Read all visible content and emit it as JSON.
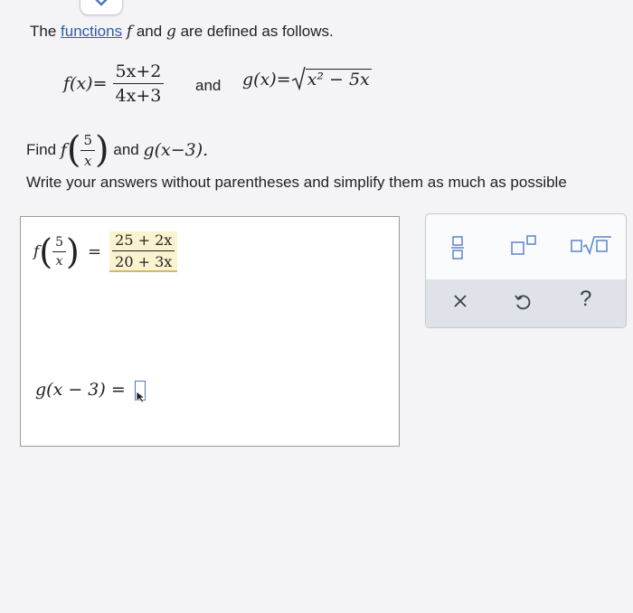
{
  "intro": {
    "prefix": "The",
    "link": "functions",
    "f": "f",
    "and": "and",
    "g": "g",
    "suffix": "are defined as follows."
  },
  "definitions": {
    "f_lhs": "f(x)=",
    "f_num": "5x+2",
    "f_den": "4x+3",
    "and_word": "and",
    "g_lhs": "g(x)=",
    "g_radicand": "x² − 5x"
  },
  "find": {
    "label": "Find",
    "f": "f",
    "frac_num": "5",
    "frac_den": "x",
    "and": "and",
    "g_expr": "g(x−3)."
  },
  "instruction": "Write your answers without parentheses and simplify them as much as possible",
  "answers": {
    "a1_f": "f",
    "a1_frac_num": "5",
    "a1_frac_den": "x",
    "a1_eq": "=",
    "a1_num": "25 + 2x",
    "a1_den": "20 + 3x",
    "a2_lhs": "g(x − 3) ="
  },
  "toolbar": {
    "icons": [
      "fraction-icon",
      "exponent-icon",
      "square-root-icon",
      "clear-icon",
      "undo-icon",
      "help-icon"
    ],
    "help_label": "?"
  },
  "colors": {
    "link": "#2a5db0",
    "highlight": "#fbf3cf",
    "accent": "#4a77c0",
    "tool_blue": "#5b84c8"
  }
}
